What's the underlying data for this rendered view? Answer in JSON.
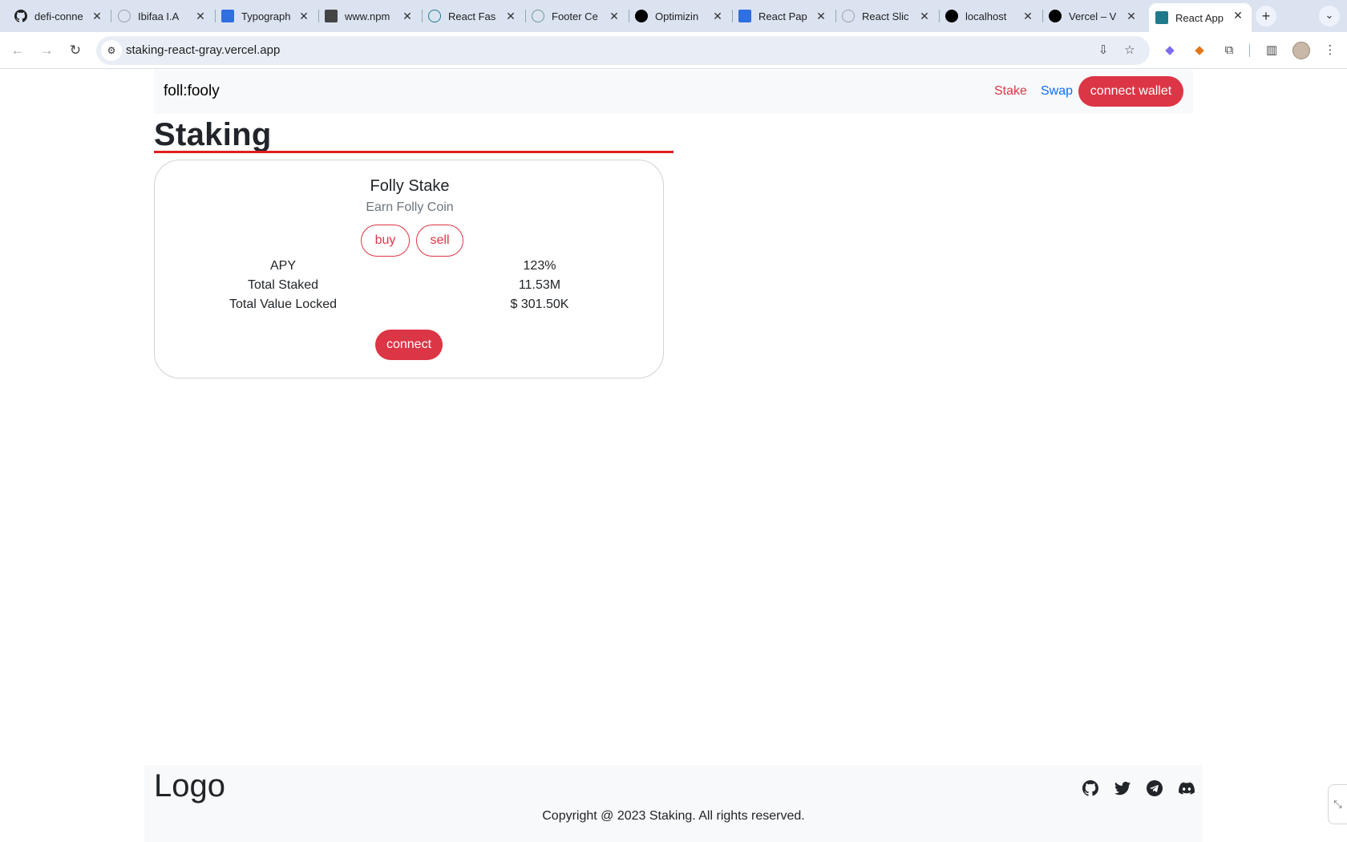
{
  "browser": {
    "tabs": [
      {
        "title": "defi-conne",
        "icon": "github-icon",
        "color": "#1f1f1f"
      },
      {
        "title": "Ibifaa I.A",
        "icon": "globe-icon",
        "color": "#9aa0a6"
      },
      {
        "title": "Typograph",
        "icon": "mui-icon",
        "color": "#2f6fdf"
      },
      {
        "title": "www.npm",
        "icon": "npm-icon",
        "color": "#444444"
      },
      {
        "title": "React Fas",
        "icon": "react-icon",
        "color": "#1f7a8c"
      },
      {
        "title": "Footer Ce",
        "icon": "chatgpt-icon",
        "color": "#6f9a8d"
      },
      {
        "title": "Optimizin",
        "icon": "nextjs-icon",
        "color": "#000000"
      },
      {
        "title": "React Pap",
        "icon": "mui-icon",
        "color": "#2f6fdf"
      },
      {
        "title": "React Slic",
        "icon": "globe-icon",
        "color": "#9aa0a6"
      },
      {
        "title": "localhost",
        "icon": "vercel-icon",
        "color": "#000000"
      },
      {
        "title": "Vercel – V",
        "icon": "vercel-icon",
        "color": "#000000"
      },
      {
        "title": "React App",
        "icon": "react-icon",
        "color": "#1f7a8c",
        "active": true
      }
    ],
    "new_tab": "+",
    "url": "staking-react-gray.vercel.app"
  },
  "navbar": {
    "brand": "foll:fooly",
    "links": {
      "stake": "Stake",
      "swap": "Swap"
    },
    "connect_wallet": "connect wallet"
  },
  "page": {
    "heading": "Staking"
  },
  "card": {
    "title": "Folly Stake",
    "subtitle": "Earn Folly Coin",
    "buy": "buy",
    "sell": "sell",
    "stats": [
      {
        "label": "APY",
        "value": "123%"
      },
      {
        "label": "Total Staked",
        "value": "11.53M"
      },
      {
        "label": "Total Value Locked",
        "value": "$ 301.50K"
      }
    ],
    "connect": "connect"
  },
  "footer": {
    "logo": "Logo",
    "social": [
      "github-icon",
      "twitter-icon",
      "telegram-icon",
      "discord-icon"
    ],
    "copyright": "Copyright @ 2023 Staking. All rights reserved."
  },
  "colors": {
    "accent": "#dc3545",
    "link_blue": "#0d6efd",
    "heading_rule": "#e01e1e"
  }
}
